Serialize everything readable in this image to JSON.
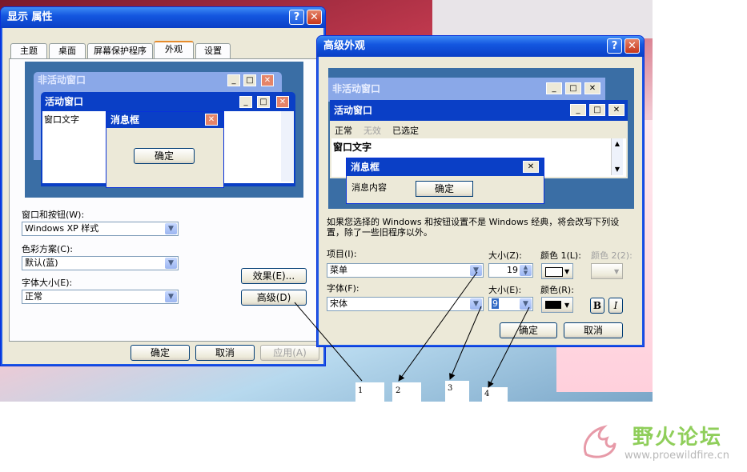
{
  "display_props": {
    "title": "显示 属性",
    "tabs": [
      "主题",
      "桌面",
      "屏幕保护程序",
      "外观",
      "设置"
    ],
    "preview": {
      "inactive_title": "非活动窗口",
      "active_title": "活动窗口",
      "window_text": "窗口文字",
      "msgbox_title": "消息框",
      "ok_label": "确定"
    },
    "labels": {
      "windows_buttons": "窗口和按钮(W):",
      "color_scheme": "色彩方案(C):",
      "font_size": "字体大小(E):"
    },
    "values": {
      "windows_buttons": "Windows XP 样式",
      "color_scheme": "默认(蓝)",
      "font_size": "正常"
    },
    "effects_label": "效果(E)...",
    "advanced_label": "高级(D)",
    "ok": "确定",
    "cancel": "取消",
    "apply": "应用(A)"
  },
  "advanced": {
    "title": "高级外观",
    "preview": {
      "inactive_title": "非活动窗口",
      "active_title": "活动窗口",
      "menu": [
        "正常",
        "无效",
        "已选定"
      ],
      "window_text": "窗口文字",
      "msgbox_title": "消息框",
      "msg_text": "消息内容",
      "ok_label": "确定"
    },
    "note": "如果您选择的 Windows 和按钮设置不是 Windows 经典，将会改写下列设置，除了一些旧程序以外。",
    "labels": {
      "item": "项目(I):",
      "size1": "大小(Z):",
      "color1": "颜色 1(L):",
      "color2": "颜色 2(2):",
      "font": "字体(F):",
      "size2": "大小(E):",
      "color": "颜色(R):"
    },
    "values": {
      "item": "菜单",
      "size1": "19",
      "font": "宋体",
      "size2": "9"
    },
    "bold": "B",
    "italic": "I",
    "ok": "确定",
    "cancel": "取消"
  },
  "annotations": [
    "1",
    "2",
    "3",
    "4"
  ],
  "watermark": {
    "name": "野火论坛",
    "url": "www.proewildfire.cn"
  },
  "colors": {
    "titlebar": "#0a3fc6",
    "desktop": "#3a6ea5",
    "close": "#c7361a"
  }
}
